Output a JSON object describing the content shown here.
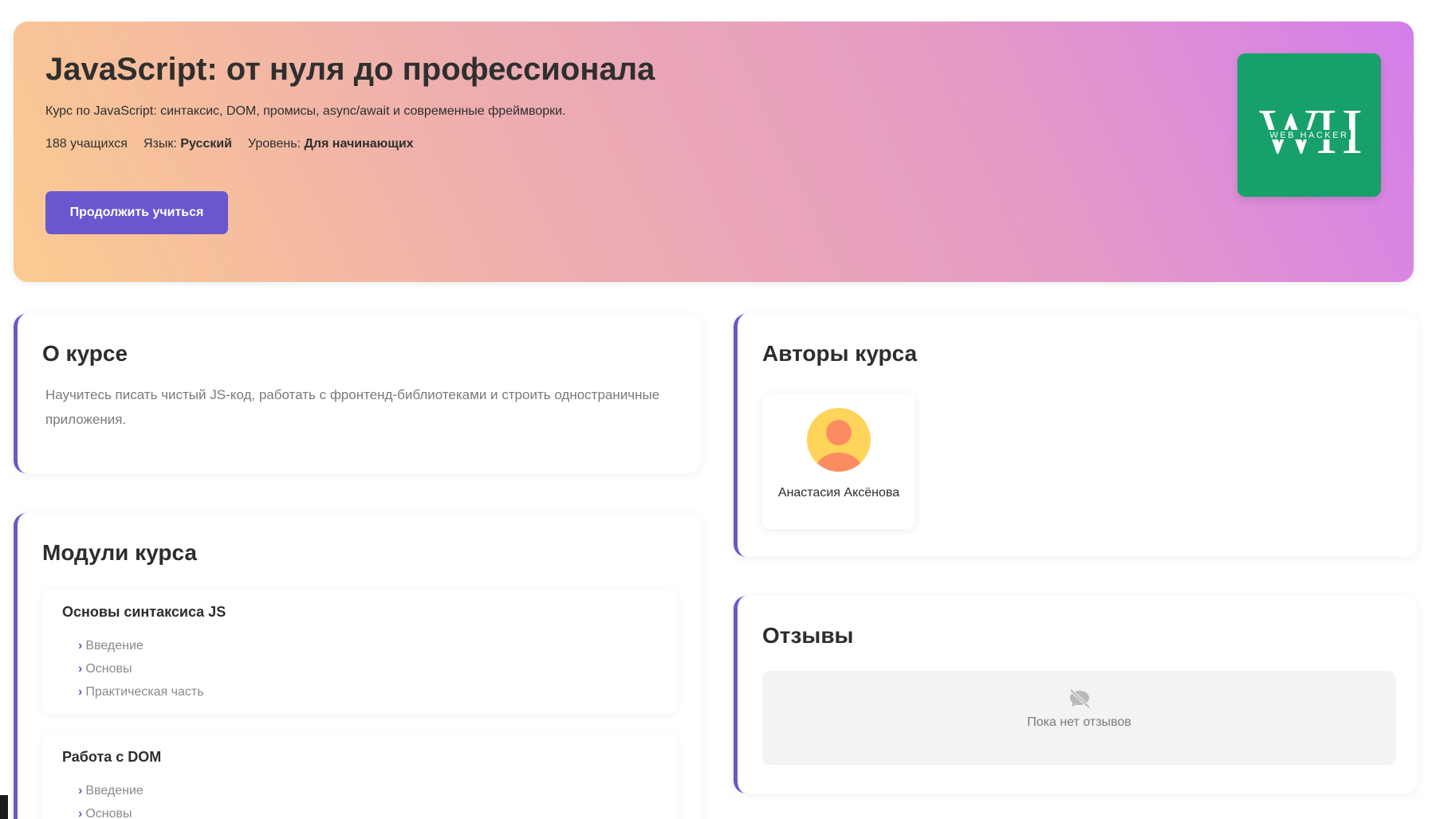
{
  "hero": {
    "title": "JavaScript: от нуля до профессионала",
    "description": "Курс по JavaScript: синтаксис, DOM, промисы, async/await и современные фреймворки.",
    "students": "188 учащихся",
    "language_label": "Язык:",
    "language_value": "Русский",
    "level_label": "Уровень:",
    "level_value": "Для начинающих",
    "continue_button": "Продолжить учиться",
    "logo_letters": "WH",
    "logo_text": "WEB HACKER"
  },
  "about": {
    "title": "О курсе",
    "text": "Научитесь писать чистый JS-код, работать с фронтенд-библиотеками и строить одностраничные приложения."
  },
  "modules": {
    "title": "Модули курса",
    "items": [
      {
        "title": "Основы синтаксиса JS",
        "lessons": [
          "Введение",
          "Основы",
          "Практическая часть"
        ]
      },
      {
        "title": "Работа с DOM",
        "lessons": [
          "Введение",
          "Основы"
        ]
      }
    ]
  },
  "authors": {
    "title": "Авторы курса",
    "items": [
      {
        "name": "Анастасия Аксёнова",
        "avatar_icon": "user-avatar-icon"
      }
    ]
  },
  "reviews": {
    "title": "Отзывы",
    "empty_text": "Пока нет отзывов",
    "empty_icon": "comment-slash-icon"
  },
  "colors": {
    "accent": "#6a57cf",
    "logo_bg": "#17a06a",
    "gradient_start": "#fccb90",
    "gradient_end": "#d57eeb"
  }
}
